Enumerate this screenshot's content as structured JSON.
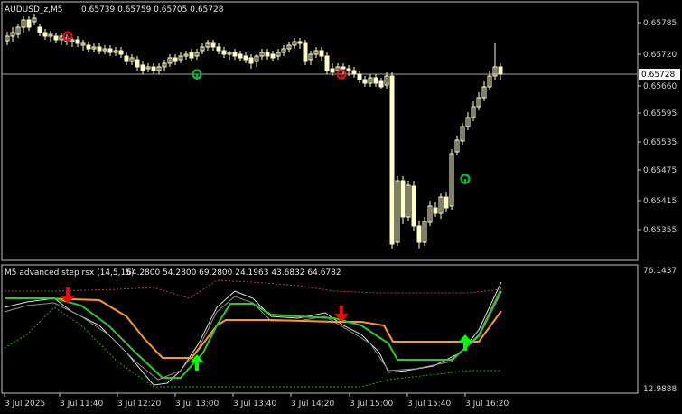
{
  "main_chart": {
    "symbol_header": "AUDUSD_z,M5",
    "ohlc_values": "0.65739 0.65759 0.65705 0.65728",
    "current_price_label": "0.65728",
    "price_ticks": [
      "0.65785",
      "0.65720",
      "0.65660",
      "0.65595",
      "0.65535",
      "0.65475",
      "0.65415",
      "0.65355"
    ]
  },
  "indicator": {
    "header": "M5 advanced step rsx (14,5,15)",
    "values": "64.2800 54.2800 69.2800 24.1963 43.6832 64.6782",
    "scale_top": "76.1437",
    "scale_bottom": "12.9888"
  },
  "time_axis": {
    "labels": [
      "3 Jul 2025",
      "3 Jul 11:40",
      "3 Jul 12:20",
      "3 Jul 13:00",
      "3 Jul 13:40",
      "3 Jul 14:20",
      "3 Jul 15:00",
      "3 Jul 15:40",
      "3 Jul 16:20"
    ]
  },
  "colors": {
    "background": "#000000",
    "frame": "#c0c0c0",
    "candle": "#ffffc8",
    "grid_price_line": "#a0a0a0",
    "signal_up": "#00ff00",
    "signal_down": "#ff0000",
    "marker_up": "#00c040",
    "marker_down": "#e01010",
    "rsx_line": "#2ec82e",
    "step_line": "#ff9a1e",
    "white_line": "#e0e0e0",
    "band_dotted": "#b04050",
    "band_dotted_low": "#30a030"
  },
  "icons": {
    "up_arrow": "arrow-up-icon",
    "down_arrow": "arrow-down-icon",
    "up_marker": "up-marker-icon",
    "down_marker": "down-marker-icon"
  }
}
